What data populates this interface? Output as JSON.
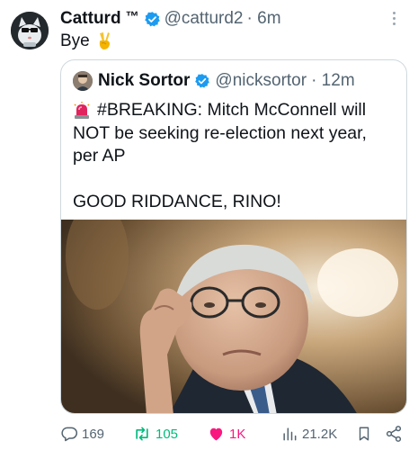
{
  "tweet": {
    "author_name": "Catturd",
    "author_suffix": "™",
    "handle": "@catturd2",
    "time": "· 6m",
    "text": "Bye",
    "text_emoji_icon": "victory-hand-icon"
  },
  "quote": {
    "author_name": "Nick Sortor",
    "handle": "@nicksortor",
    "time": "· 12m",
    "lines": [
      "#BREAKING: Mitch McConnell will",
      "NOT be seeking re-election next year,",
      "per AP",
      "",
      "GOOD RIDDANCE, RINO!"
    ],
    "lead_emoji_icon": "police-siren-icon"
  },
  "actions": {
    "replies": "169",
    "retweets": "105",
    "likes": "1K",
    "views": "21.2K"
  },
  "colors": {
    "verified": "#1d9bf0",
    "retweeted": "#00ba7c",
    "liked": "#f91880",
    "muted": "#536471"
  }
}
